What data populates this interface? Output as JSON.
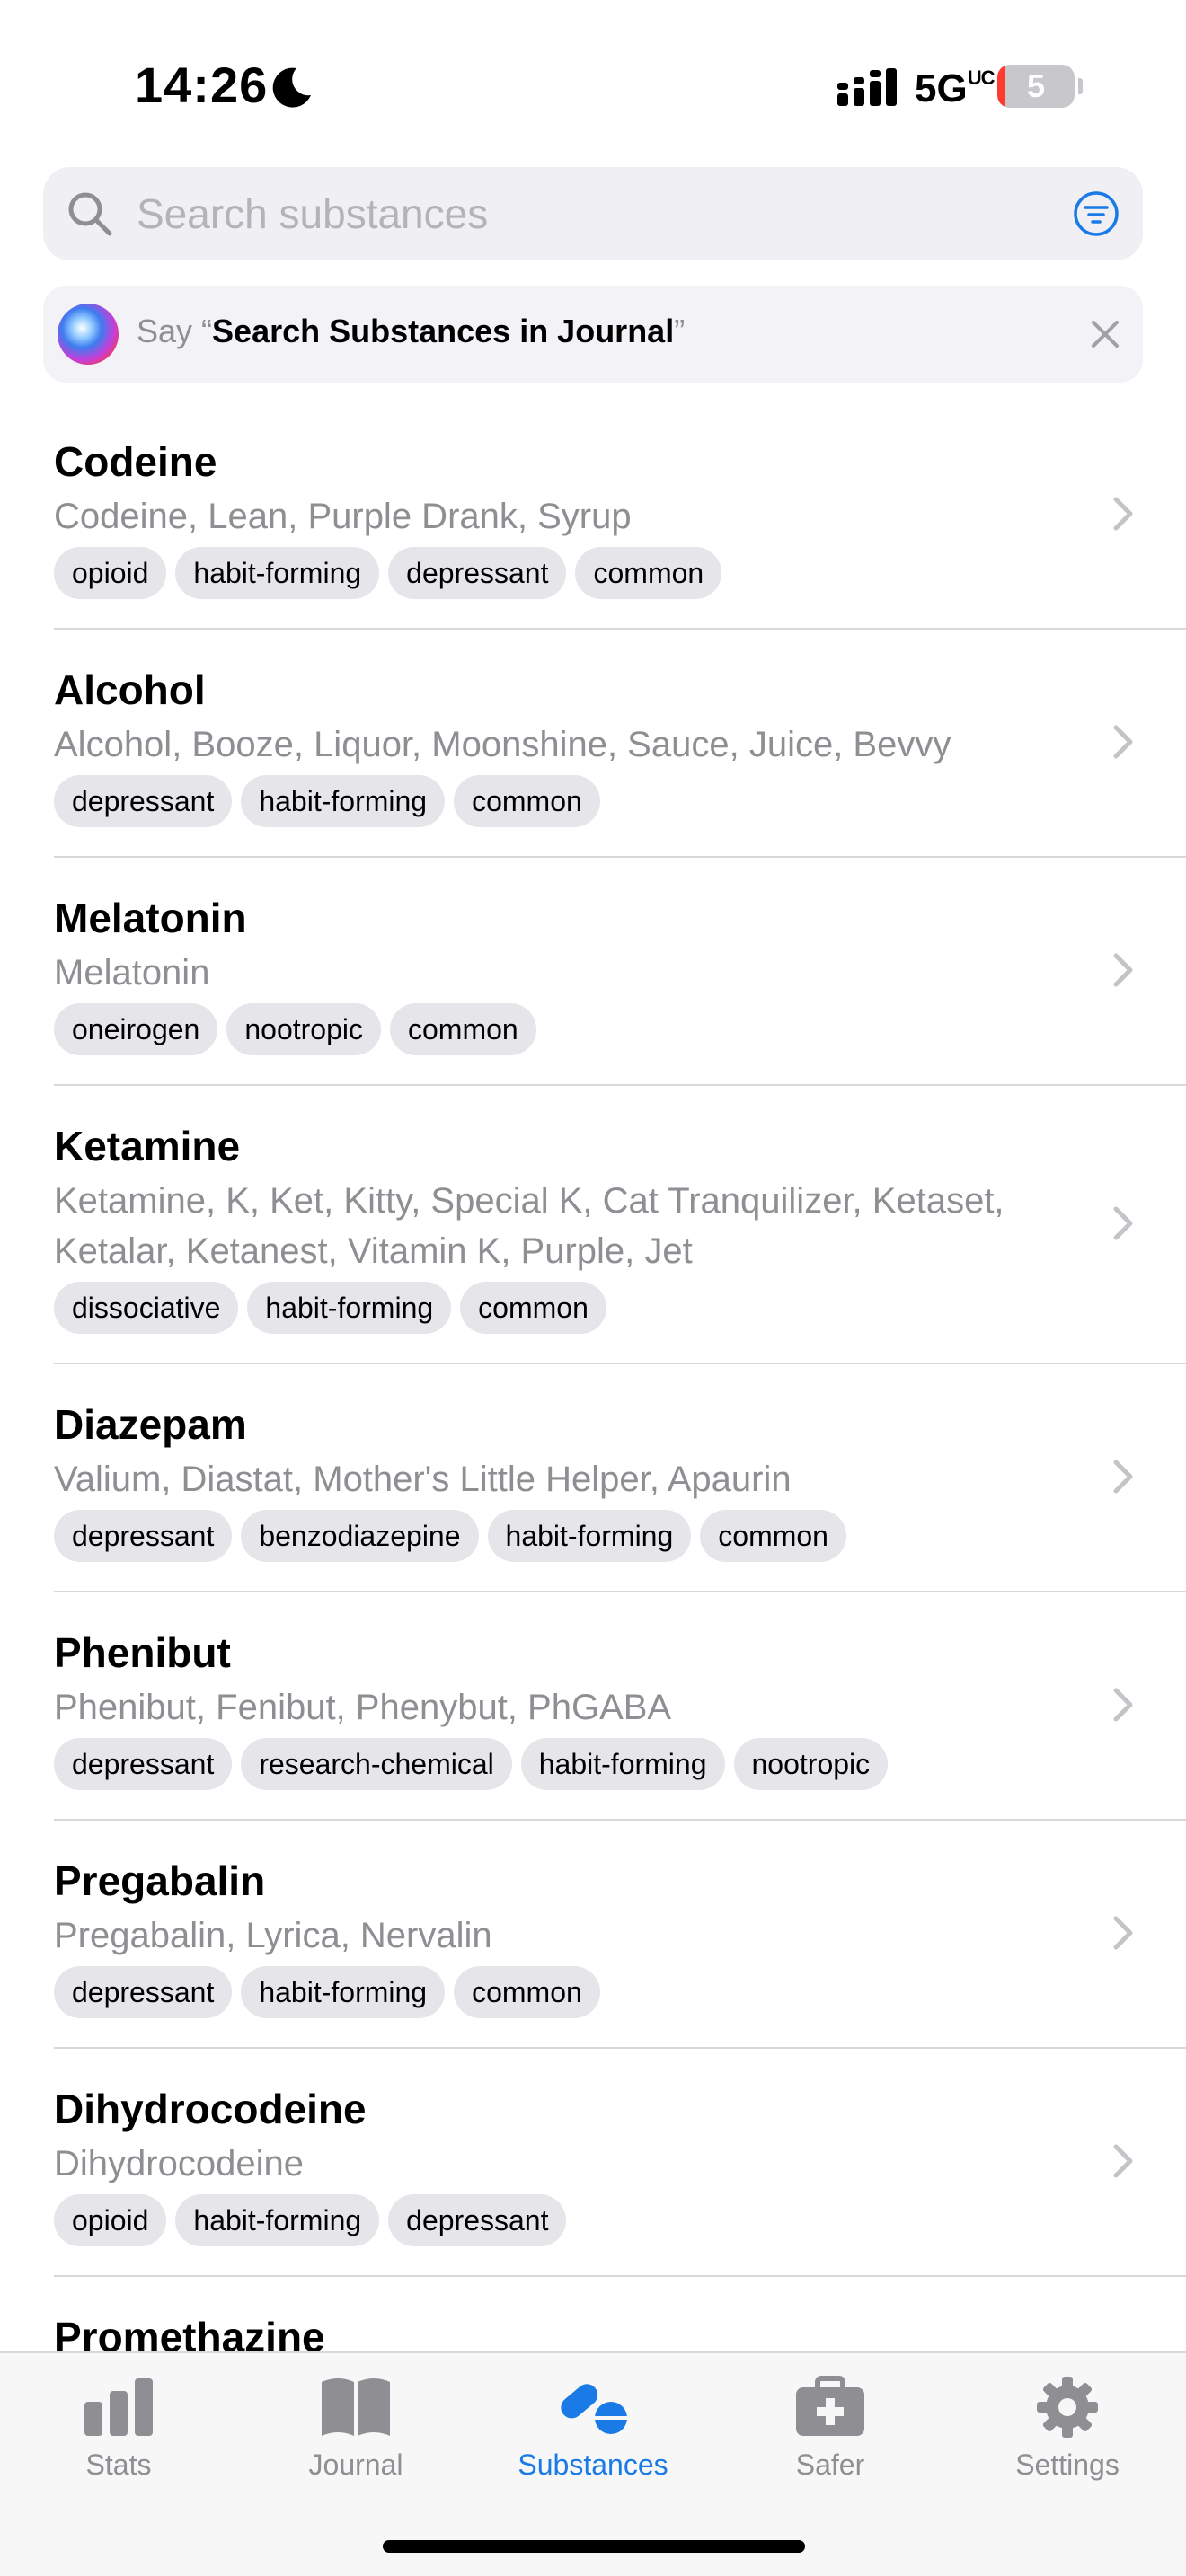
{
  "status_bar": {
    "time": "14:26",
    "network": "5G",
    "network_sub": "UC",
    "battery_level": "5",
    "battery_fraction": 0.05
  },
  "search": {
    "placeholder": "Search substances",
    "value": ""
  },
  "siri_tip": {
    "prefix": "Say “",
    "phrase": "Search Substances in Journal",
    "suffix": "”"
  },
  "substances": [
    {
      "name": "Codeine",
      "aliases": "Codeine, Lean, Purple Drank, Syrup",
      "tags": [
        "opioid",
        "habit-forming",
        "depressant",
        "common"
      ]
    },
    {
      "name": "Alcohol",
      "aliases": "Alcohol, Booze, Liquor, Moonshine, Sauce, Juice, Bevvy",
      "tags": [
        "depressant",
        "habit-forming",
        "common"
      ]
    },
    {
      "name": "Melatonin",
      "aliases": "Melatonin",
      "tags": [
        "oneirogen",
        "nootropic",
        "common"
      ]
    },
    {
      "name": "Ketamine",
      "aliases": "Ketamine, K, Ket, Kitty, Special K, Cat Tranquilizer, Ketaset, Ketalar, Ketanest, Vitamin K, Purple, Jet",
      "tags": [
        "dissociative",
        "habit-forming",
        "common"
      ]
    },
    {
      "name": "Diazepam",
      "aliases": "Valium, Diastat, Mother's Little Helper, Apaurin",
      "tags": [
        "depressant",
        "benzodiazepine",
        "habit-forming",
        "common"
      ]
    },
    {
      "name": "Phenibut",
      "aliases": "Phenibut, Fenibut, Phenybut, PhGABA",
      "tags": [
        "depressant",
        "research-chemical",
        "habit-forming",
        "nootropic"
      ]
    },
    {
      "name": "Pregabalin",
      "aliases": "Pregabalin, Lyrica, Nervalin",
      "tags": [
        "depressant",
        "habit-forming",
        "common"
      ]
    },
    {
      "name": "Dihydrocodeine",
      "aliases": "Dihydrocodeine",
      "tags": [
        "opioid",
        "habit-forming",
        "depressant"
      ]
    },
    {
      "name": "Promethazine",
      "aliases": "",
      "tags": []
    }
  ],
  "tab_bar": {
    "tabs": [
      {
        "label": "Stats",
        "icon": "bar-chart-icon",
        "active": false
      },
      {
        "label": "Journal",
        "icon": "book-icon",
        "active": false
      },
      {
        "label": "Substances",
        "icon": "pills-icon",
        "active": true
      },
      {
        "label": "Safer",
        "icon": "first-aid-kit-icon",
        "active": false
      },
      {
        "label": "Settings",
        "icon": "gear-icon",
        "active": false
      }
    ]
  },
  "colors": {
    "accent": "#1a7ae6",
    "tag_background": "#e5e5ea",
    "secondary_text": "#8e8e93",
    "battery_low": "#ff3b30"
  }
}
